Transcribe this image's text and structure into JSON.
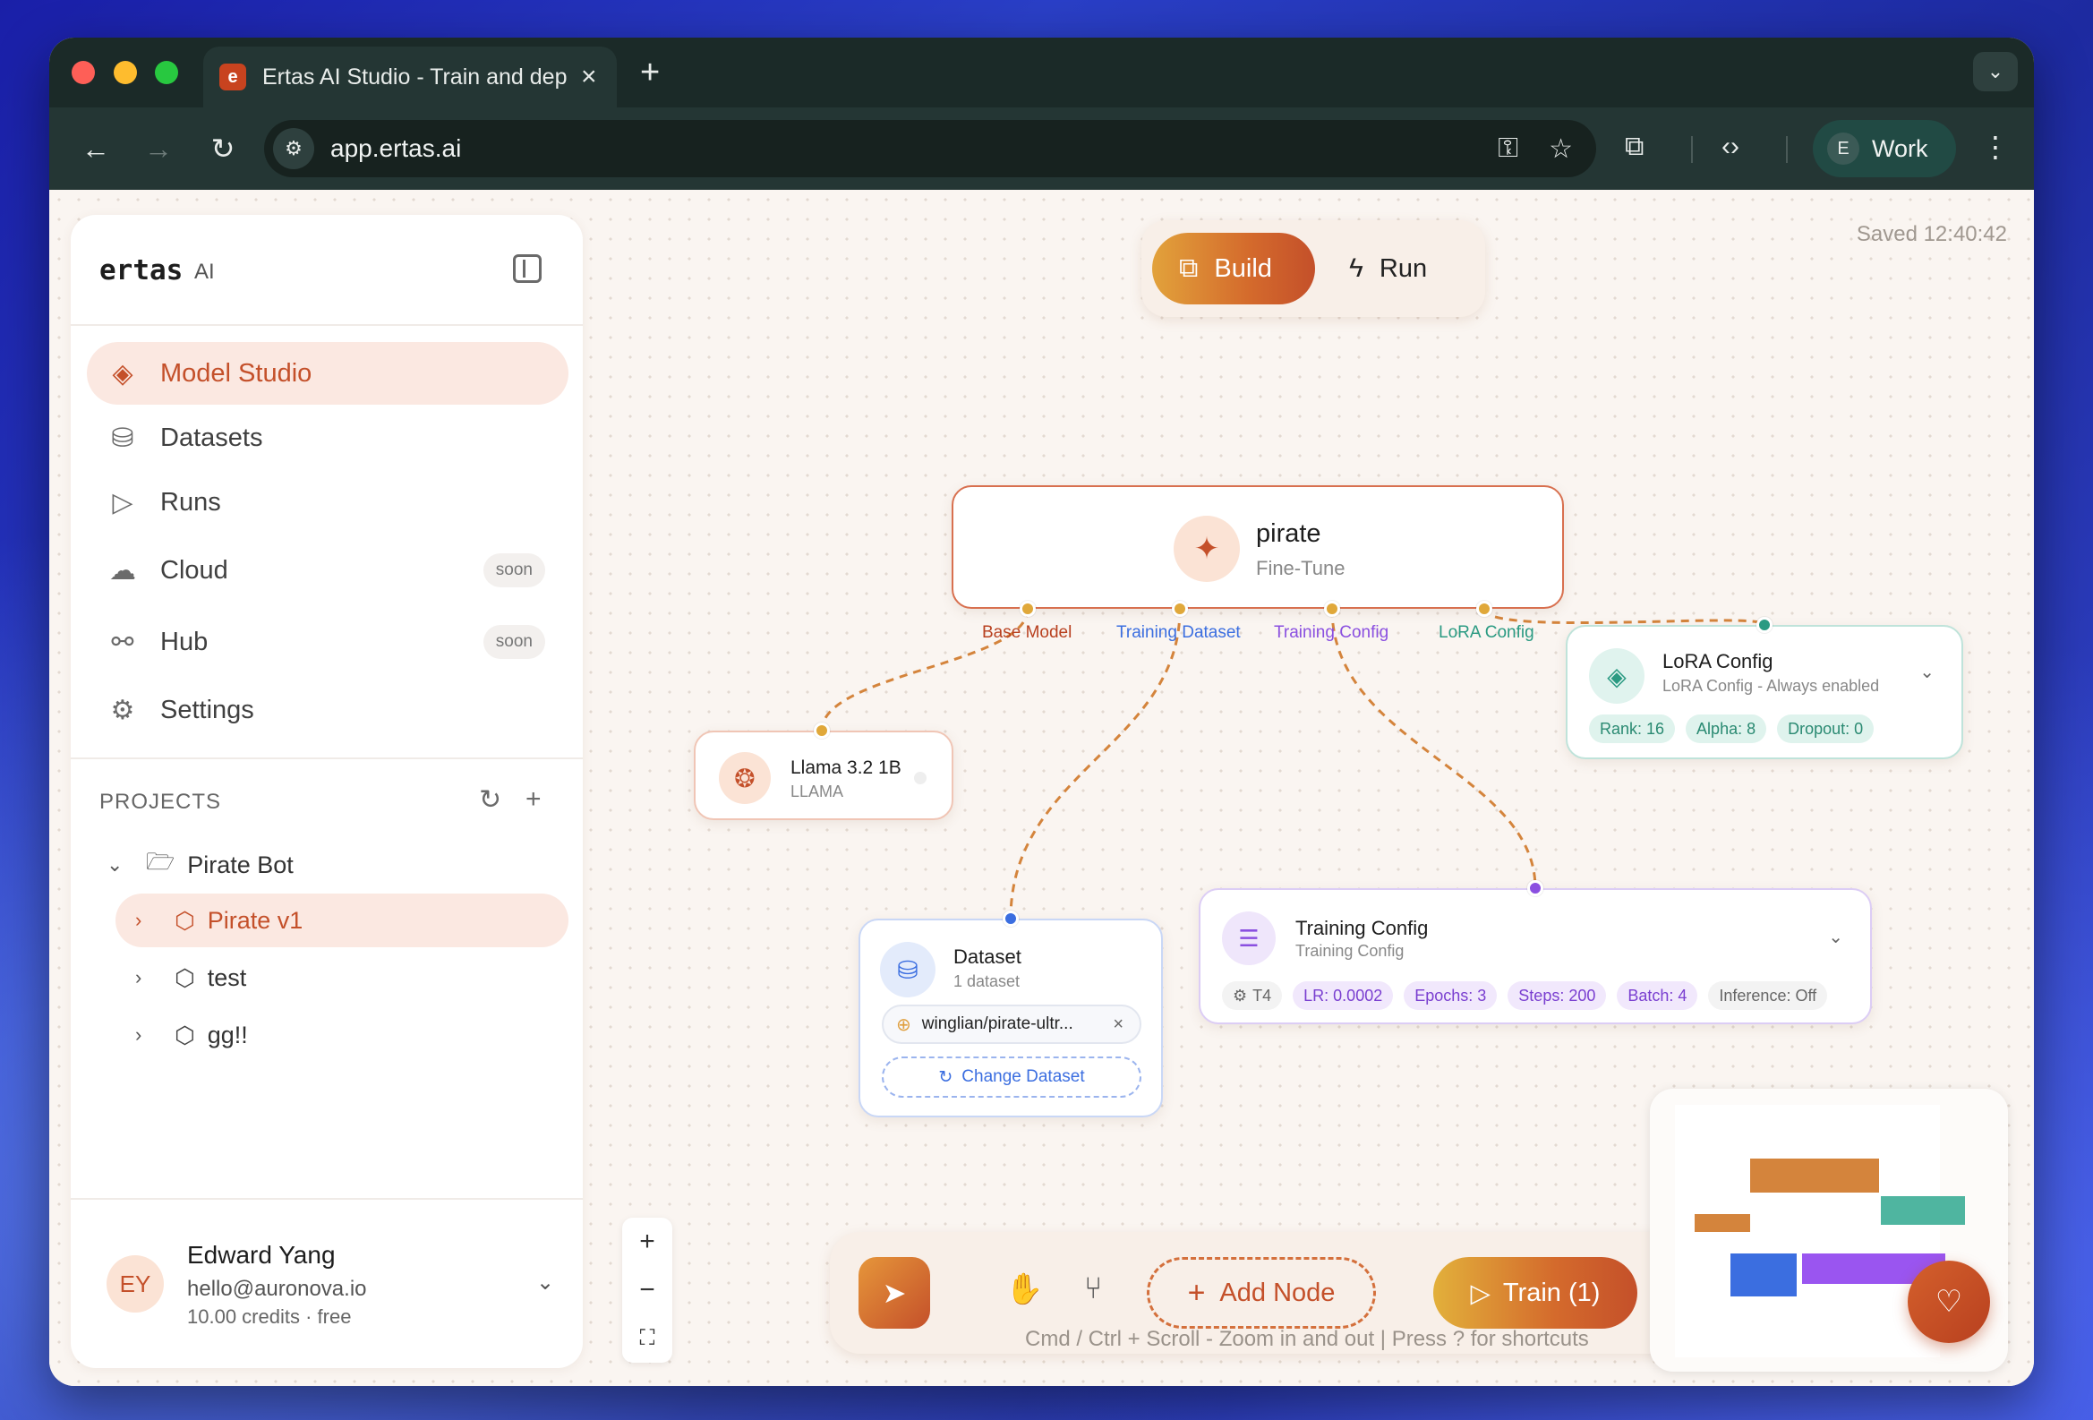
{
  "browser": {
    "tab_title": "Ertas AI Studio - Train and deploy",
    "favicon_letter": "e",
    "url": "app.ertas.ai",
    "profile_initial": "E",
    "profile_name": "Work"
  },
  "sidebar": {
    "brand": "ertas",
    "brand_suffix": "AI",
    "nav": [
      {
        "label": "Model Studio",
        "icon": "layers-icon",
        "active": true
      },
      {
        "label": "Datasets",
        "icon": "database-icon"
      },
      {
        "label": "Runs",
        "icon": "play-icon"
      },
      {
        "label": "Cloud",
        "icon": "cloud-icon",
        "badge": "soon"
      },
      {
        "label": "Hub",
        "icon": "share-icon",
        "badge": "soon"
      },
      {
        "label": "Settings",
        "icon": "gear-icon"
      }
    ],
    "projects_heading": "PROJECTS",
    "tree": {
      "folder": "Pirate Bot",
      "items": [
        "Pirate v1",
        "test",
        "gg!!"
      ]
    },
    "user": {
      "initials": "EY",
      "name": "Edward Yang",
      "email": "hello@auronova.io",
      "credits": "10.00 credits · free"
    }
  },
  "canvas": {
    "mode_build": "Build",
    "mode_run": "Run",
    "saved": "Saved 12:40:42",
    "main_node": {
      "title": "pirate",
      "subtitle": "Fine-Tune",
      "ports": [
        "Base Model",
        "Training Dataset",
        "Training Config",
        "LoRA Config"
      ]
    },
    "model_node": {
      "title": "Llama 3.2 1B",
      "subtitle": "LLAMA"
    },
    "dataset_node": {
      "title": "Dataset",
      "subtitle": "1 dataset",
      "dataset_name": "winglian/pirate-ultr...",
      "change_label": "Change Dataset"
    },
    "training_node": {
      "title": "Training Config",
      "subtitle": "Training Config",
      "tags": [
        "T4",
        "LR: 0.0002",
        "Epochs: 3",
        "Steps: 200",
        "Batch: 4",
        "Inference: Off"
      ]
    },
    "lora_node": {
      "title": "LoRA Config",
      "subtitle": "LoRA Config - Always enabled",
      "tags": [
        "Rank: 16",
        "Alpha: 8",
        "Dropout: 0"
      ]
    },
    "toolbar": {
      "add_node": "Add Node",
      "train": "Train (1)"
    },
    "hint": "Cmd / Ctrl + Scroll - Zoom in and out | Press ? for shortcuts",
    "colors": {
      "accent": "#c4502a",
      "base_model": "#b8401f",
      "dataset": "#3b6ee0",
      "training": "#8a4fe0",
      "lora": "#2a9a82",
      "edge": "#d4843c"
    }
  }
}
